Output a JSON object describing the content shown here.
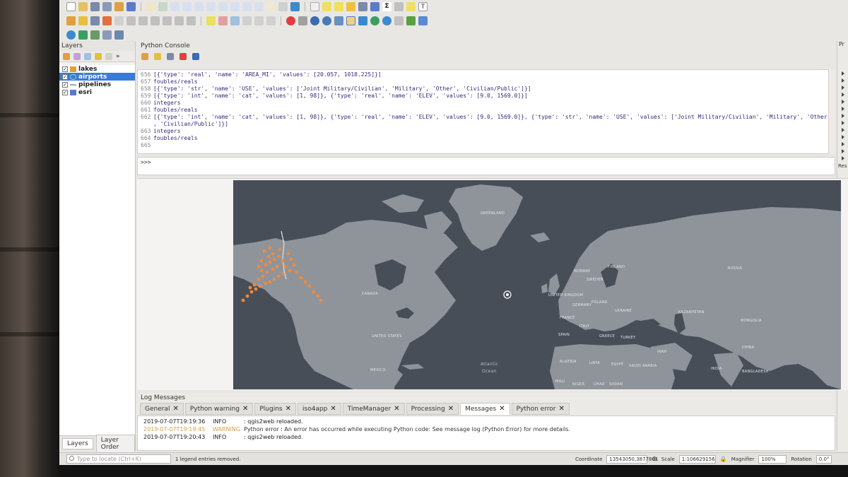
{
  "layers_panel": {
    "title": "Layers",
    "layers": [
      {
        "name": "lakes",
        "checked": true
      },
      {
        "name": "airports",
        "checked": true,
        "selected": true
      },
      {
        "name": "pipelines",
        "checked": true
      },
      {
        "name": "esri",
        "checked": true
      }
    ],
    "tabs": [
      "Layers",
      "Layer Order"
    ]
  },
  "python_console": {
    "title": "Python Console",
    "lines": [
      {
        "n": "656",
        "text": "[{'type': 'real', 'name': 'AREA_MI', 'values': [20.057, 1018.225]}]"
      },
      {
        "n": "657",
        "text": "foubles/reals"
      },
      {
        "n": "658",
        "text": "[{'type': 'str', 'name': 'USE', 'values': ['Joint Military/Civilian', 'Military', 'Other', 'Civilian/Public']}]"
      },
      {
        "n": "659",
        "text": "[{'type': 'int', 'name': 'cat', 'values': [1, 98]}, {'type': 'real', 'name': 'ELEV', 'values': [9.0, 1569.0]}]"
      },
      {
        "n": "660",
        "text": "integers"
      },
      {
        "n": "661",
        "text": "foubles/reals"
      },
      {
        "n": "662",
        "text": "[{'type': 'int', 'name': 'cat', 'values': [1, 98]}, {'type': 'real', 'name': 'ELEV', 'values': [9.0, 1569.0]}, {'type': 'str', 'name': 'USE', 'values': ['Joint Military/Civilian', 'Military', 'Other'\n, 'Civilian/Public']}]"
      },
      {
        "n": "663",
        "text": "integers"
      },
      {
        "n": "664",
        "text": "foubles/reals"
      },
      {
        "n": "665",
        "text": ""
      }
    ],
    "prompt": ">>>"
  },
  "map": {
    "labels": [
      {
        "text": "GREENLAND"
      },
      {
        "text": "CANADA"
      },
      {
        "text": "UNITED STATES"
      },
      {
        "text": "MEXICO"
      },
      {
        "text": "Atlantic"
      },
      {
        "text": "Ocean"
      },
      {
        "text": "NORWAY"
      },
      {
        "text": "FINLAND"
      },
      {
        "text": "SWEDEN"
      },
      {
        "text": "UNITED KINGDOM"
      },
      {
        "text": "GERMANY"
      },
      {
        "text": "POLAND"
      },
      {
        "text": "UKRAINE"
      },
      {
        "text": "FRANCE"
      },
      {
        "text": "ITALY"
      },
      {
        "text": "SPAIN"
      },
      {
        "text": "GREECE"
      },
      {
        "text": "TURKEY"
      },
      {
        "text": "RUSSIA"
      },
      {
        "text": "KAZAKHSTAN"
      },
      {
        "text": "MONGOLIA"
      },
      {
        "text": "CHINA"
      },
      {
        "text": "IRAN"
      },
      {
        "text": "INDIA"
      },
      {
        "text": "ALGERIA"
      },
      {
        "text": "LIBYA"
      },
      {
        "text": "EGYPT"
      },
      {
        "text": "SAUDI ARABIA"
      },
      {
        "text": "MALI"
      },
      {
        "text": "NIGER"
      },
      {
        "text": "CHAD"
      },
      {
        "text": "SUDAN"
      },
      {
        "text": "BANGLADESH"
      }
    ],
    "land_color": "#8f949b",
    "ocean_color": "#484e58",
    "point_color": "#f08a3c"
  },
  "log_panel": {
    "title": "Log Messages",
    "tabs": [
      {
        "label": "General",
        "active": false
      },
      {
        "label": "Python warning",
        "active": false
      },
      {
        "label": "Plugins",
        "active": false
      },
      {
        "label": "iso4app",
        "active": false
      },
      {
        "label": "TimeManager",
        "active": false
      },
      {
        "label": "Processing",
        "active": false
      },
      {
        "label": "Messages",
        "active": true
      },
      {
        "label": "Python error",
        "active": false
      }
    ],
    "entries": [
      {
        "ts": "2019-07-07T19:19:36",
        "level": "INFO",
        "msg": ": qgis2web reloaded."
      },
      {
        "ts": "2019-07-07T19:19:45",
        "level": "WARNING",
        "msg": "Python error : An error has occurred while executing Python code: See message log (Python Error) for more details."
      },
      {
        "ts": "2019-07-07T19:20:43",
        "level": "INFO",
        "msg": ": qgis2web reloaded."
      }
    ]
  },
  "status_bar": {
    "locate_placeholder": "Type to locate (Ctrl+K)",
    "legend_msg": "1 legend entries removed.",
    "coordinate_label": "Coordinate",
    "coordinate_value": "13543050,3877801",
    "scale_label": "Scale",
    "scale_value": "1:106629156",
    "magnifier_label": "Magnifier",
    "magnifier_value": "100%",
    "rotation_label": "Rotation",
    "rotation_value": "0.0°"
  },
  "right_dock": {
    "label_top": "Pr",
    "label_res": "Res"
  }
}
